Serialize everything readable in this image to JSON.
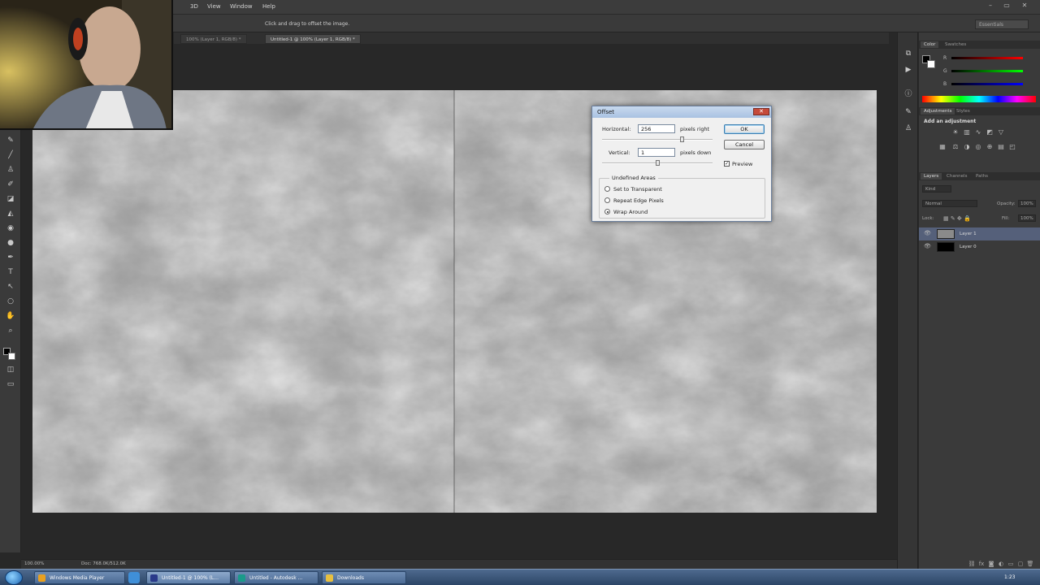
{
  "menu": {
    "items": [
      "3D",
      "View",
      "Window",
      "Help"
    ],
    "window_controls": [
      "–",
      "▭",
      "✕"
    ]
  },
  "options_bar": {
    "hint": "Click and drag to offset the image.",
    "workspace": "Essentials"
  },
  "tabs": [
    {
      "label": "100% (Layer 1, RGB/8) *"
    },
    {
      "label": "Untitled-1 @ 100% (Layer 1, RGB/8) *"
    }
  ],
  "dialog": {
    "title": "Offset",
    "close_glyph": "✕",
    "horizontal_label": "Horizontal:",
    "horizontal_value": "256",
    "horizontal_unit": "pixels right",
    "vertical_label": "Vertical:",
    "vertical_value": "1",
    "vertical_unit": "pixels down",
    "ok_label": "OK",
    "cancel_label": "Cancel",
    "preview_label": "Preview",
    "preview_checked": true,
    "preview_mark": "✓",
    "group_title": "Undefined Areas",
    "options": [
      {
        "label": "Set to Transparent",
        "checked": false
      },
      {
        "label": "Repeat Edge Pixels",
        "checked": false
      },
      {
        "label": "Wrap Around",
        "checked": true
      }
    ]
  },
  "status": {
    "zoom": "100.00%",
    "doc": "Doc: 768.0K/512.0K"
  },
  "panels": {
    "color_tabs": [
      "Color",
      "Swatches"
    ],
    "color_channels": [
      "R",
      "G",
      "B"
    ],
    "adjust_tabs": [
      "Adjustments",
      "Styles"
    ],
    "adjust_title": "Add an adjustment",
    "layer_tabs": [
      "Layers",
      "Channels",
      "Paths"
    ],
    "kind": "Kind",
    "blend_mode": "Normal",
    "opacity_label": "Opacity:",
    "opacity_value": "100%",
    "lock_label": "Lock:",
    "fill_label": "Fill:",
    "fill_value": "100%",
    "layers": [
      {
        "name": "Layer 1",
        "selected": true
      },
      {
        "name": "Layer 0",
        "selected": false
      }
    ]
  },
  "taskbar": {
    "items": [
      {
        "label": "Windows Media Player",
        "color": "#e8a020"
      },
      {
        "label": "Untitled-1 @ 100% (L...",
        "color": "#2a3a8a"
      },
      {
        "label": "Untitled - Autodesk ...",
        "color": "#1a9a8a"
      },
      {
        "label": "Downloads",
        "color": "#e8c040"
      }
    ],
    "clock": "1:23"
  },
  "colors": {
    "accent": "#55607a",
    "dialog_titlebar": "#a9c2e2"
  }
}
